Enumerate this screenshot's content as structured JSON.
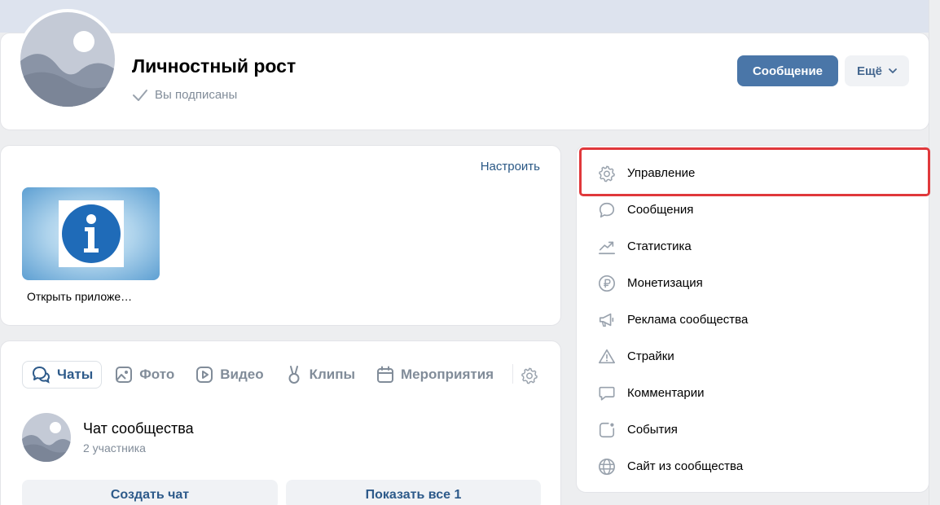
{
  "header": {
    "title": "Личностный рост",
    "subscribed_label": "Вы подписаны",
    "message_button": "Сообщение",
    "more_button": "Ещё"
  },
  "apps": {
    "configure_link": "Настроить",
    "app_caption": "Открыть приложе…"
  },
  "chats": {
    "tabs": [
      {
        "label": "Чаты",
        "icon": "chat-bubbles-icon",
        "active": true
      },
      {
        "label": "Фото",
        "icon": "photo-icon",
        "active": false
      },
      {
        "label": "Видео",
        "icon": "video-icon",
        "active": false
      },
      {
        "label": "Клипы",
        "icon": "clips-icon",
        "active": false
      },
      {
        "label": "Мероприятия",
        "icon": "calendar-icon",
        "active": false
      }
    ],
    "chat": {
      "name": "Чат сообщества",
      "members": "2 участника"
    },
    "create_button": "Создать чат",
    "show_all_button": "Показать все 1"
  },
  "menu": {
    "items": [
      {
        "label": "Управление",
        "icon": "gear-icon"
      },
      {
        "label": "Сообщения",
        "icon": "chat-bubble-icon"
      },
      {
        "label": "Статистика",
        "icon": "trend-chart-icon"
      },
      {
        "label": "Монетизация",
        "icon": "ruble-coin-icon"
      },
      {
        "label": "Реклама сообщества",
        "icon": "megaphone-icon"
      },
      {
        "label": "Страйки",
        "icon": "warning-triangle-icon"
      },
      {
        "label": "Комментарии",
        "icon": "comment-icon"
      },
      {
        "label": "События",
        "icon": "event-icon"
      },
      {
        "label": "Сайт из сообщества",
        "icon": "globe-icon"
      }
    ],
    "highlighted_index": 0
  },
  "colors": {
    "primary_button": "#4a76a8",
    "link": "#2a5885",
    "secondary_text": "#818c99",
    "highlight_border": "#e0383b"
  }
}
